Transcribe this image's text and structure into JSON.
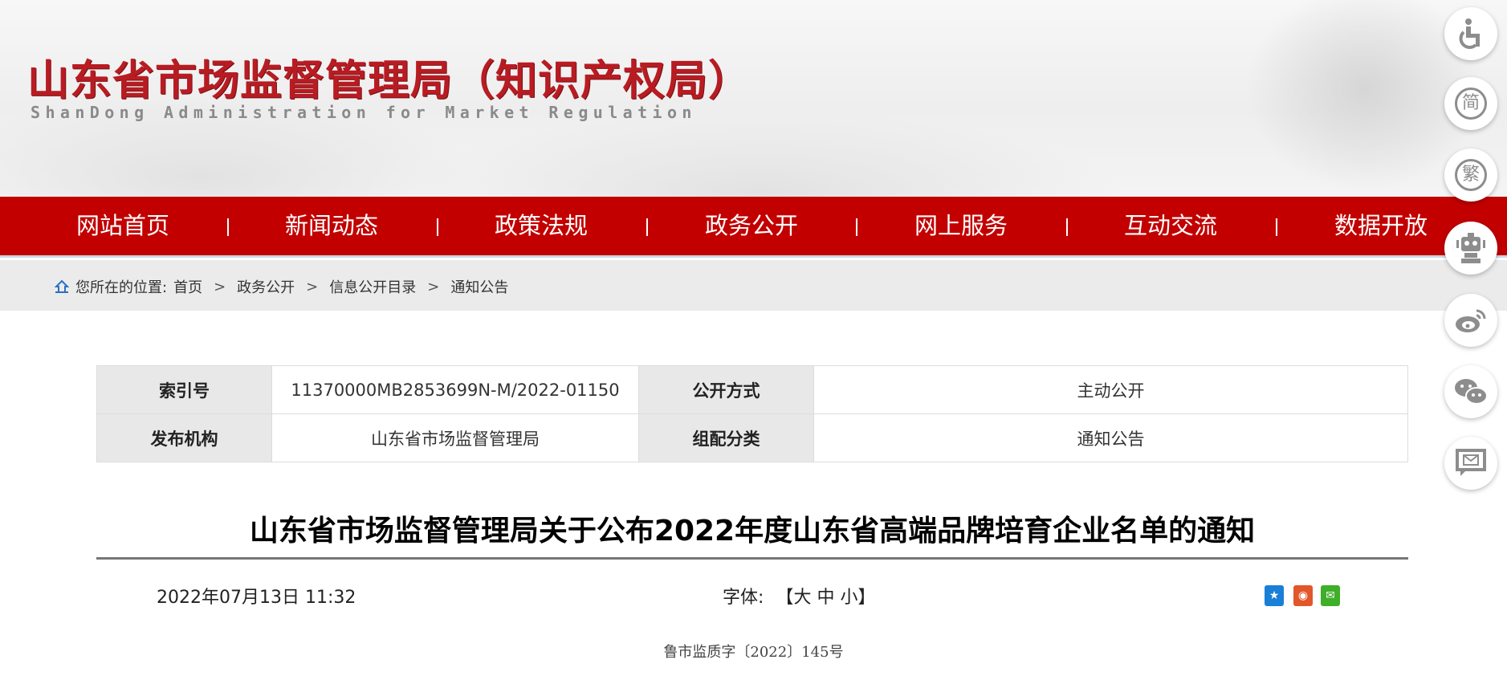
{
  "header": {
    "logo_cn": "山东省市场监督管理局（知识产权局）",
    "logo_en": "ShanDong Administration for Market Regulation"
  },
  "nav": [
    "网站首页",
    "新闻动态",
    "政策法规",
    "政务公开",
    "网上服务",
    "互动交流",
    "数据开放"
  ],
  "breadcrumb": {
    "prefix": "您所在的位置:",
    "items": [
      "首页",
      "政务公开",
      "信息公开目录",
      "通知公告"
    ],
    "separator": ">"
  },
  "meta": {
    "index_label": "索引号",
    "index_value": "11370000MB2853699N-M/2022-01150",
    "disclosure_label": "公开方式",
    "disclosure_value": "主动公开",
    "publisher_label": "发布机构",
    "publisher_value": "山东省市场监督管理局",
    "category_label": "组配分类",
    "category_value": "通知公告"
  },
  "article": {
    "title": "山东省市场监督管理局关于公布2022年度山东省高端品牌培育企业名单的通知",
    "date": "2022年07月13日 11:32",
    "font_label": "字体:",
    "font_open": "【",
    "font_large": "大",
    "font_medium": "中",
    "font_small": "小",
    "font_close": "】",
    "doc_number": "鲁市监质字〔2022〕145号"
  },
  "share": [
    {
      "name": "qzone",
      "color": "#1a7fd6",
      "glyph": "★"
    },
    {
      "name": "weibo",
      "color": "#e2562b",
      "glyph": "◉"
    },
    {
      "name": "wechat",
      "color": "#3fae29",
      "glyph": "✉"
    }
  ],
  "float_tools": {
    "simplified": "简",
    "traditional": "繁"
  }
}
